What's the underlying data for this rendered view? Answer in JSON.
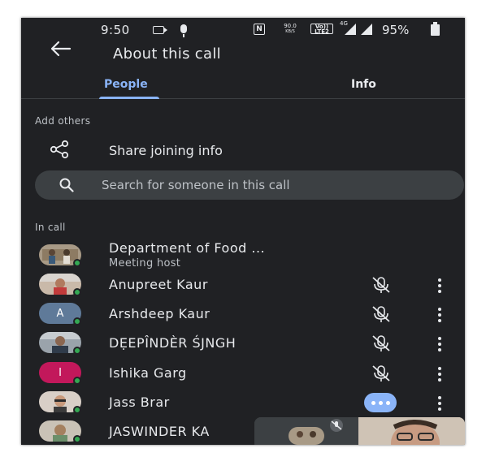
{
  "status_bar": {
    "time": "9:50",
    "speed_value": "90.0",
    "speed_unit": "KB/S",
    "volte_top": "Vo))",
    "volte_bottom": "LTE2",
    "network_label": "4G",
    "battery": "95%"
  },
  "header": {
    "title": "About this call"
  },
  "tabs": [
    {
      "label": "People",
      "active": true
    },
    {
      "label": "Info",
      "active": false
    }
  ],
  "add_others": {
    "section_label": "Add others",
    "share_label": "Share joining info"
  },
  "search": {
    "placeholder": "Search for someone in this call",
    "value": ""
  },
  "in_call": {
    "section_label": "In call",
    "participants": [
      {
        "name": "Department of Food ...",
        "subtitle": "Meeting host",
        "avatar": "photo"
      },
      {
        "name": "Anupreet Kaur",
        "avatar": "photo",
        "status": "mic-off"
      },
      {
        "name": "Arshdeep Kaur",
        "avatar_letter": "A",
        "avatar_color": "#5f7a99",
        "status": "mic-off"
      },
      {
        "name": "DẸEPÎNDÈR ŚJNGH",
        "avatar": "photo",
        "status": "mic-off"
      },
      {
        "name": "Ishika Garg",
        "avatar_letter": "I",
        "avatar_color": "#c2185b",
        "status": "mic-off"
      },
      {
        "name": "Jass Brar",
        "avatar": "photo",
        "status": "speaking"
      },
      {
        "name": "JASWINDER KA",
        "avatar": "photo"
      }
    ]
  },
  "colors": {
    "background": "#202124",
    "accent": "#8ab4f8",
    "presence": "#34a853"
  }
}
